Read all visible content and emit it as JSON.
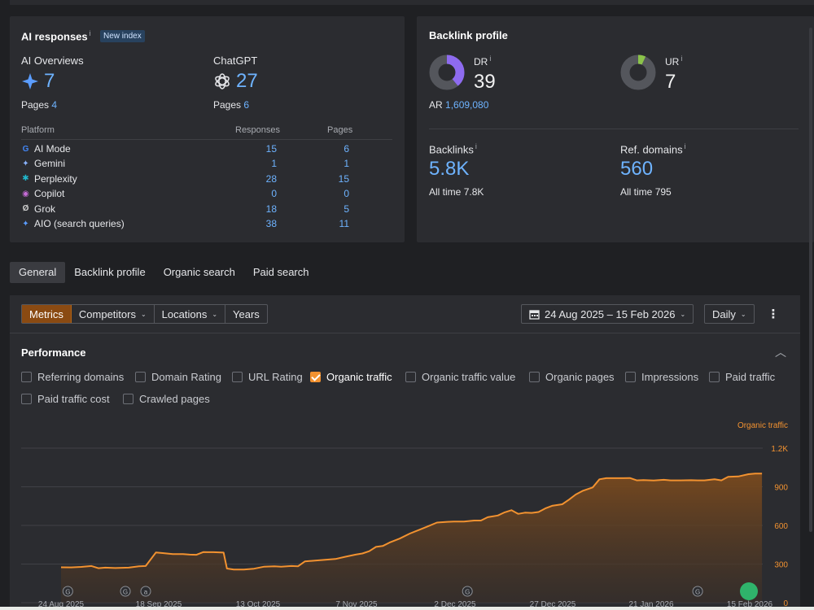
{
  "ai_card": {
    "title": "AI responses",
    "info": "i",
    "badge": "New index",
    "overviews": {
      "label": "AI Overviews",
      "icon": "sparkle-icon",
      "value": "7",
      "pages_label": "Pages",
      "pages": "4"
    },
    "chatgpt": {
      "label": "ChatGPT",
      "icon": "openai-icon",
      "value": "27",
      "pages_label": "Pages",
      "pages": "6"
    },
    "columns": [
      "Platform",
      "Responses",
      "Pages"
    ],
    "rows": [
      {
        "icon": "google-icon",
        "glyph": "G",
        "color": "#4285f4",
        "platform": "AI Mode",
        "responses": "15",
        "pages": "6"
      },
      {
        "icon": "gemini-icon",
        "glyph": "✦",
        "color": "#8ab4ff",
        "platform": "Gemini",
        "responses": "1",
        "pages": "1"
      },
      {
        "icon": "perplexity-icon",
        "glyph": "✱",
        "color": "#20b8cd",
        "platform": "Perplexity",
        "responses": "28",
        "pages": "15"
      },
      {
        "icon": "copilot-icon",
        "glyph": "◉",
        "color": "#c56bd6",
        "platform": "Copilot",
        "responses": "0",
        "pages": "0"
      },
      {
        "icon": "grok-icon",
        "glyph": "Ø",
        "color": "#d0d0d0",
        "platform": "Grok",
        "responses": "18",
        "pages": "5"
      },
      {
        "icon": "sparkle-icon",
        "glyph": "✦",
        "color": "#5b9dff",
        "platform": "AIO (search queries)",
        "responses": "38",
        "pages": "11"
      }
    ]
  },
  "backlink_card": {
    "title": "Backlink profile",
    "dr": {
      "label": "DR",
      "info": "i",
      "value": "39",
      "ring_fraction": 0.39,
      "ring_color": "#8e6bf0"
    },
    "ar": {
      "label": "AR",
      "value": "1,609,080"
    },
    "ur": {
      "label": "UR",
      "info": "i",
      "value": "7",
      "ring_fraction": 0.07,
      "ring_color": "#8bc34a"
    },
    "backlinks": {
      "label": "Backlinks",
      "info": "i",
      "value": "5.8K",
      "alltime_label": "All time",
      "alltime": "7.8K"
    },
    "ref_domains": {
      "label": "Ref. domains",
      "info": "i",
      "value": "560",
      "alltime_label": "All time",
      "alltime": "795"
    }
  },
  "tabs": [
    "General",
    "Backlink profile",
    "Organic search",
    "Paid search"
  ],
  "toolbar": {
    "segments": [
      "Metrics",
      "Competitors",
      "Locations",
      "Years"
    ],
    "date_range": "24 Aug 2025 – 15 Feb 2026",
    "granularity": "Daily"
  },
  "performance": {
    "title": "Performance",
    "checkboxes": [
      {
        "label": "Referring domains",
        "checked": false
      },
      {
        "label": "Domain Rating",
        "checked": false
      },
      {
        "label": "URL Rating",
        "checked": false
      },
      {
        "label": "Organic traffic",
        "checked": true
      },
      {
        "label": "Organic traffic value",
        "checked": false
      },
      {
        "label": "Organic pages",
        "checked": false
      },
      {
        "label": "Impressions",
        "checked": false
      },
      {
        "label": "Paid traffic",
        "checked": false
      },
      {
        "label": "Paid traffic cost",
        "checked": false
      },
      {
        "label": "Crawled pages",
        "checked": false
      }
    ]
  },
  "chart_data": {
    "type": "area",
    "series": [
      {
        "name": "Organic traffic",
        "color": "#f29230"
      }
    ],
    "ylabel": "Organic traffic",
    "ylim": [
      0,
      1200
    ],
    "yticks": [
      "0",
      "300",
      "600",
      "900",
      "1.2K"
    ],
    "xticks": [
      "24 Aug 2025",
      "18 Sep 2025",
      "13 Oct 2025",
      "7 Nov 2025",
      "2 Dec 2025",
      "27 Dec 2025",
      "21 Jan 2026",
      "15 Feb 2026"
    ],
    "grid": true,
    "points": [
      [
        0,
        275
      ],
      [
        3,
        274
      ],
      [
        6,
        278
      ],
      [
        9,
        285
      ],
      [
        11,
        268
      ],
      [
        13,
        272
      ],
      [
        16,
        269
      ],
      [
        20,
        272
      ],
      [
        23,
        283
      ],
      [
        25,
        285
      ],
      [
        28,
        390
      ],
      [
        30,
        385
      ],
      [
        33,
        378
      ],
      [
        36,
        378
      ],
      [
        38,
        373
      ],
      [
        40,
        372
      ],
      [
        42,
        393
      ],
      [
        45,
        392
      ],
      [
        48,
        389
      ],
      [
        49,
        265
      ],
      [
        51,
        258
      ],
      [
        54,
        258
      ],
      [
        57,
        264
      ],
      [
        60,
        280
      ],
      [
        63,
        283
      ],
      [
        65,
        280
      ],
      [
        68,
        285
      ],
      [
        70,
        283
      ],
      [
        72,
        320
      ],
      [
        75,
        327
      ],
      [
        78,
        333
      ],
      [
        81,
        339
      ],
      [
        84,
        357
      ],
      [
        87,
        373
      ],
      [
        89,
        382
      ],
      [
        91,
        400
      ],
      [
        93,
        433
      ],
      [
        95,
        440
      ],
      [
        97,
        467
      ],
      [
        100,
        498
      ],
      [
        103,
        537
      ],
      [
        106,
        568
      ],
      [
        108,
        589
      ],
      [
        111,
        622
      ],
      [
        114,
        628
      ],
      [
        116,
        630
      ],
      [
        119,
        630
      ],
      [
        122,
        638
      ],
      [
        124,
        638
      ],
      [
        126,
        664
      ],
      [
        129,
        677
      ],
      [
        131,
        702
      ],
      [
        133,
        718
      ],
      [
        135,
        690
      ],
      [
        137,
        699
      ],
      [
        139,
        697
      ],
      [
        141,
        704
      ],
      [
        143,
        732
      ],
      [
        145,
        752
      ],
      [
        148,
        764
      ],
      [
        150,
        800
      ],
      [
        152,
        840
      ],
      [
        154,
        868
      ],
      [
        157,
        895
      ],
      [
        159,
        958
      ],
      [
        161,
        967
      ],
      [
        164,
        967
      ],
      [
        166,
        967
      ],
      [
        168,
        968
      ],
      [
        170,
        950
      ],
      [
        172,
        952
      ],
      [
        175,
        949
      ],
      [
        178,
        954
      ],
      [
        180,
        950
      ],
      [
        183,
        950
      ],
      [
        186,
        951
      ],
      [
        188,
        950
      ],
      [
        190,
        950
      ],
      [
        193,
        958
      ],
      [
        195,
        950
      ],
      [
        197,
        978
      ],
      [
        200,
        980
      ],
      [
        203,
        998
      ],
      [
        205,
        1003
      ],
      [
        207,
        1003
      ]
    ],
    "x_markers": [
      {
        "day": 2,
        "label": "G"
      },
      {
        "day": 19,
        "label": "G"
      },
      {
        "day": 25,
        "label": "a"
      },
      {
        "day": 120,
        "label": "G"
      },
      {
        "day": 188,
        "label": "G"
      }
    ]
  }
}
